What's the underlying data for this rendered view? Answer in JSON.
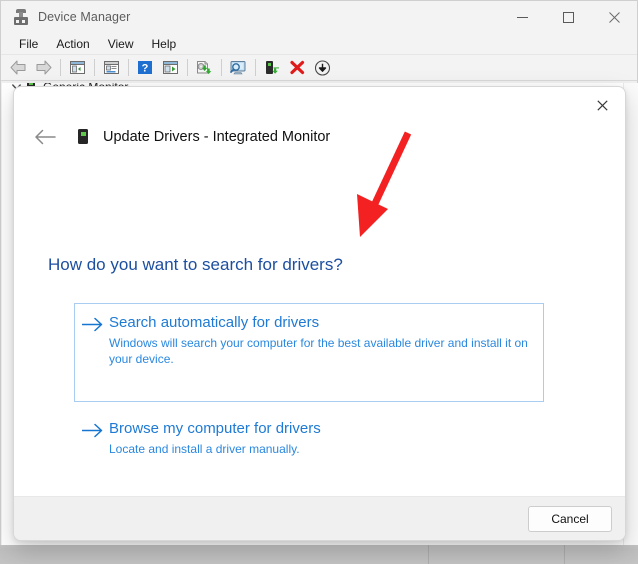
{
  "window": {
    "title": "Device Manager",
    "icon": "device-manager-icon",
    "controls": {
      "minimize": "minimize-icon",
      "maximize": "maximize-icon",
      "close": "close-icon"
    },
    "menu": [
      {
        "label": "File"
      },
      {
        "label": "Action"
      },
      {
        "label": "View"
      },
      {
        "label": "Help"
      }
    ],
    "toolbar": [
      {
        "name": "back-icon"
      },
      {
        "name": "forward-icon"
      },
      {
        "name": "separator"
      },
      {
        "name": "show-hidden-devices-icon"
      },
      {
        "name": "separator"
      },
      {
        "name": "properties-icon"
      },
      {
        "name": "separator"
      },
      {
        "name": "help-icon"
      },
      {
        "name": "scan-for-hardware-changes-icon"
      },
      {
        "name": "separator"
      },
      {
        "name": "update-driver-icon"
      },
      {
        "name": "separator"
      },
      {
        "name": "scan-monitor-icon"
      },
      {
        "name": "separator"
      },
      {
        "name": "disable-device-icon"
      },
      {
        "name": "uninstall-device-icon"
      },
      {
        "name": "install-device-icon"
      }
    ]
  },
  "tree": {
    "node_label": "Generic Monitor"
  },
  "dialog": {
    "close_label": "✕",
    "back_label": "←",
    "device_icon": "monitor-device-icon",
    "title": "Update Drivers - Integrated Monitor",
    "question": "How do you want to search for drivers?",
    "options": [
      {
        "arrow": "→",
        "title": "Search automatically for drivers",
        "description": "Windows will search your computer for the best available driver and install it on your device.",
        "highlighted": true
      },
      {
        "arrow": "→",
        "title": "Browse my computer for drivers",
        "description": "Locate and install a driver manually.",
        "highlighted": false
      }
    ],
    "cancel_label": "Cancel"
  },
  "annotation": {
    "type": "red-arrow",
    "color": "#f32121",
    "points_to": "search-automatically-for-drivers"
  },
  "colors": {
    "accent_blue": "#1e7ad4",
    "heading_blue": "#1d4fa0",
    "highlight_border": "#a9cdf0",
    "window_chrome": "#f3f3f3"
  }
}
